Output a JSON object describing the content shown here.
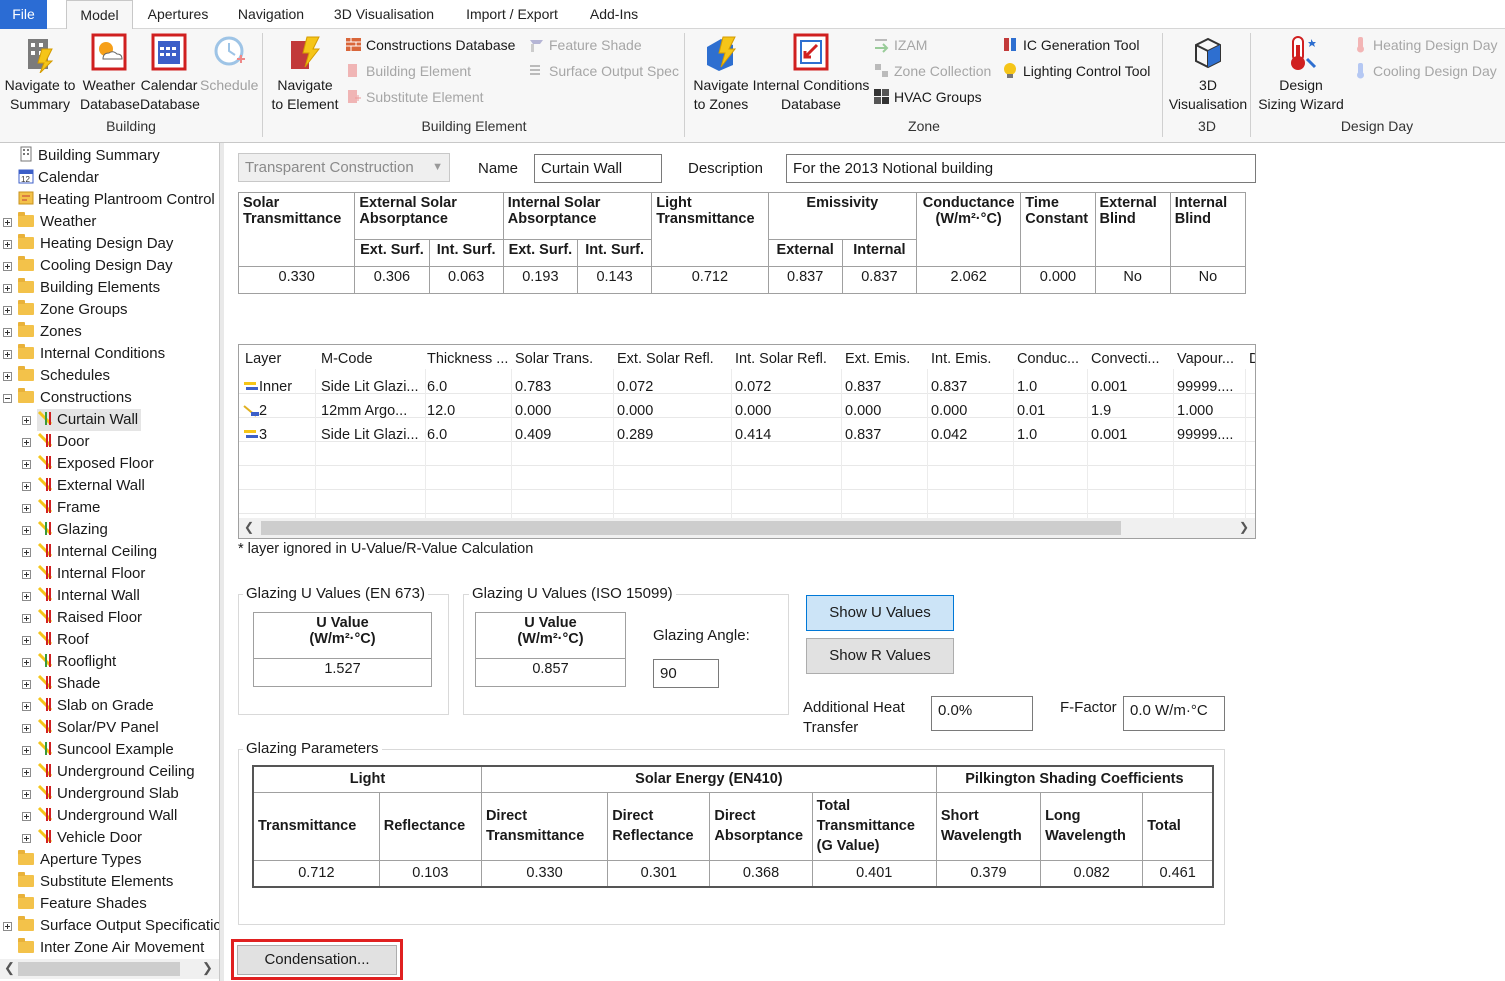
{
  "menu": {
    "tabs": [
      "File",
      "Model",
      "Apertures",
      "Navigation",
      "3D Visualisation",
      "Import / Export",
      "Add-Ins"
    ]
  },
  "ribbon": {
    "groups": {
      "building": "Building",
      "building_element": "Building Element",
      "zone": "Zone",
      "d3": "3D",
      "design_day": "Design Day"
    },
    "building": {
      "navigate_summary": [
        "Navigate to",
        "Summary"
      ],
      "weather_db": [
        "Weather",
        "Database"
      ],
      "calendar_db": [
        "Calendar",
        "Database"
      ],
      "schedule": "Schedule"
    },
    "building_element": {
      "navigate_element": [
        "Navigate",
        "to Element"
      ],
      "constructions_db": "Constructions Database",
      "building_element": "Building Element",
      "substitute_element": "Substitute Element",
      "feature_shade": "Feature Shade",
      "surface_output_spec": "Surface Output Spec"
    },
    "zone": {
      "navigate_zones": [
        "Navigate",
        "to Zones"
      ],
      "internal_conditions_db": [
        "Internal Conditions",
        "Database"
      ],
      "izam": "IZAM",
      "zone_collection": "Zone Collection",
      "hvac_groups": "HVAC Groups",
      "ic_generation": "IC Generation Tool",
      "lighting_control": "Lighting Control Tool"
    },
    "d3": {
      "visualisation": [
        "3D",
        "Visualisation"
      ]
    },
    "design_day": {
      "wizard": [
        "Design",
        "Sizing Wizard"
      ],
      "heating": "Heating Design Day",
      "cooling": "Cooling Design Day"
    }
  },
  "tree": {
    "top": [
      "Building Summary",
      "Calendar",
      "Heating Plantroom Control",
      "Weather",
      "Heating Design Day",
      "Cooling Design Day",
      "Building Elements",
      "Zone Groups",
      "Zones",
      "Internal Conditions",
      "Schedules",
      "Constructions"
    ],
    "constructions": [
      "Curtain Wall",
      "Door",
      "Exposed Floor",
      "External Wall",
      "Frame",
      "Glazing",
      "Internal Ceiling",
      "Internal Floor",
      "Internal Wall",
      "Raised Floor",
      "Roof",
      "Rooflight",
      "Shade",
      "Slab on Grade",
      "Solar/PV Panel",
      "Suncool Example",
      "Underground Ceiling",
      "Underground Slab",
      "Underground Wall",
      "Vehicle Door"
    ],
    "bottom": [
      "Aperture Types",
      "Substitute Elements",
      "Feature Shades",
      "Surface Output Specificatic",
      "Inter Zone Air Movement"
    ]
  },
  "form": {
    "type_value": "Transparent Construction",
    "name_label": "Name",
    "name_value": "Curtain Wall",
    "desc_label": "Description",
    "desc_value": "For the 2013 Notional building"
  },
  "props": {
    "headers": {
      "solar": "Solar Transmittance",
      "ext_abs": "External Solar Absorptance",
      "int_abs": "Internal Solar Absorptance",
      "light": "Light Transmittance",
      "emiss": "Emissivity",
      "cond": "Conductance (W/m²·°C)",
      "time": "Time Constant",
      "ext_blind": "External Blind",
      "int_blind": "Internal Blind"
    },
    "sub": {
      "ext_surf": "Ext. Surf.",
      "int_surf": "Int. Surf.",
      "external": "External",
      "internal": "Internal"
    },
    "values": {
      "solar": "0.330",
      "ext_abs_ext": "0.306",
      "ext_abs_int": "0.063",
      "int_abs_ext": "0.193",
      "int_abs_int": "0.143",
      "light": "0.712",
      "em_ext": "0.837",
      "em_int": "0.837",
      "cond": "2.062",
      "time": "0.000",
      "ext_blind": "No",
      "int_blind": "No"
    }
  },
  "layers": {
    "columns": [
      "Layer",
      "M-Code",
      "Thickness ...",
      "Solar Trans.",
      "Ext. Solar Refl.",
      "Int. Solar Refl.",
      "Ext. Emis.",
      "Int. Emis.",
      "Conduc...",
      "Convecti...",
      "Vapour...",
      "D"
    ],
    "rows": [
      [
        "Inner",
        "Side Lit Glazi...",
        "6.0",
        "0.783",
        "0.072",
        "0.072",
        "0.837",
        "0.837",
        "1.0",
        "0.001",
        "99999...."
      ],
      [
        "2",
        "12mm Argo...",
        "12.0",
        "0.000",
        "0.000",
        "0.000",
        "0.000",
        "0.000",
        "0.01",
        "1.9",
        "1.000"
      ],
      [
        "3",
        "Side Lit Glazi...",
        "6.0",
        "0.409",
        "0.289",
        "0.414",
        "0.837",
        "0.042",
        "1.0",
        "0.001",
        "99999...."
      ]
    ],
    "note": "* layer ignored in U-Value/R-Value Calculation"
  },
  "uvalues": {
    "en673_title": "Glazing U Values (EN 673)",
    "iso_title": "Glazing U Values (ISO 15099)",
    "u_header": [
      "U Value",
      "(W/m²·°C)"
    ],
    "en673_value": "1.527",
    "iso_value": "0.857",
    "angle_label": "Glazing Angle:",
    "angle_value": "90",
    "show_u": "Show U Values",
    "show_r": "Show R Values",
    "add_heat_label": [
      "Additional Heat",
      "Transfer"
    ],
    "add_heat_value": "0.0%",
    "ffactor_label": "F-Factor",
    "ffactor_value": "0.0 W/m·°C"
  },
  "glazing_params": {
    "title": "Glazing Parameters",
    "groups": [
      "Light",
      "Solar Energy (EN410)",
      "Pilkington Shading Coefficients"
    ],
    "cols": [
      [
        "Transmittance"
      ],
      [
        "Reflectance"
      ],
      [
        "Direct",
        "Transmittance"
      ],
      [
        "Direct",
        "Reflectance"
      ],
      [
        "Direct",
        "Absorptance"
      ],
      [
        "Total",
        "Transmittance",
        "(G Value)"
      ],
      [
        "Short",
        "Wavelength"
      ],
      [
        "Long",
        "Wavelength"
      ],
      [
        "Total"
      ]
    ],
    "values": [
      "0.712",
      "0.103",
      "0.330",
      "0.301",
      "0.368",
      "0.401",
      "0.379",
      "0.082",
      "0.461"
    ]
  },
  "condensation_button": "Condensation..."
}
